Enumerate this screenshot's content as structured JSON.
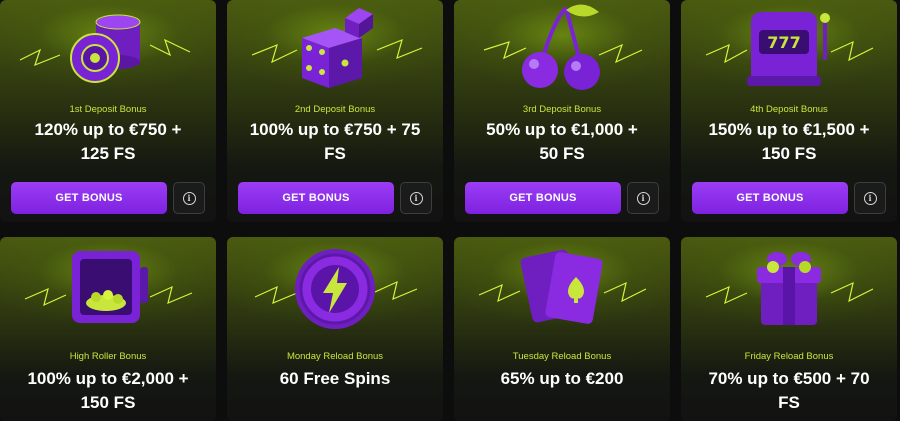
{
  "bonuses": [
    {
      "subtitle": "1st Deposit Bonus",
      "line1": "120% up to €750 +",
      "line2": "125 FS",
      "button": "GET BONUS",
      "info": "i",
      "icon": "poker-chips-icon"
    },
    {
      "subtitle": "2nd Deposit Bonus",
      "line1": "100% up to €750 + 75",
      "line2": "FS",
      "button": "GET BONUS",
      "info": "i",
      "icon": "dice-icon"
    },
    {
      "subtitle": "3rd Deposit Bonus",
      "line1": "50% up to €1,000 +",
      "line2": "50 FS",
      "button": "GET BONUS",
      "info": "i",
      "icon": "cherries-icon"
    },
    {
      "subtitle": "4th Deposit Bonus",
      "line1": "150% up to €1,500 +",
      "line2": "150 FS",
      "button": "GET BONUS",
      "info": "i",
      "icon": "slot-machine-icon"
    },
    {
      "subtitle": "High Roller Bonus",
      "line1": "100% up to €2,000 +",
      "line2": "150 FS",
      "icon": "safe-icon"
    },
    {
      "subtitle": "Monday Reload Bonus",
      "line1": "60 Free Spins",
      "line2": "",
      "icon": "lightning-coin-icon"
    },
    {
      "subtitle": "Tuesday Reload Bonus",
      "line1": "65% up to €200",
      "line2": "",
      "icon": "playing-cards-icon"
    },
    {
      "subtitle": "Friday Reload Bonus",
      "line1": "70% up to €500 + 70",
      "line2": "FS",
      "icon": "gift-box-icon"
    }
  ],
  "colors": {
    "accent": "#8b2cf0",
    "subtitle": "#c9e63c",
    "lightning": "#d6f53a"
  },
  "slot_digits": "777"
}
